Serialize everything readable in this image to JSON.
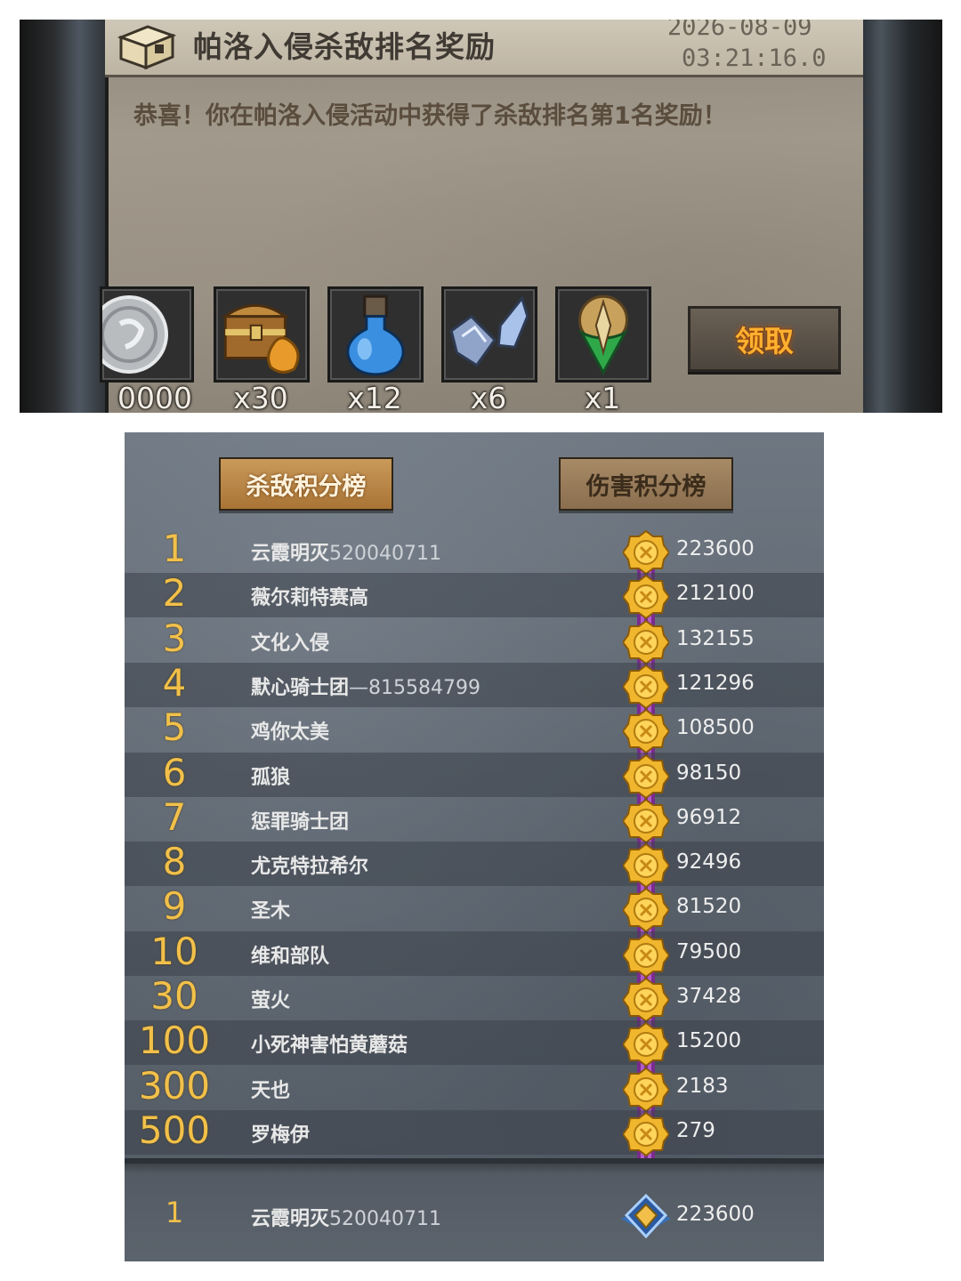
{
  "mail": {
    "title": "帕洛入侵杀敌排名奖励",
    "date": "2026-08-09",
    "time": "03:21:16.0",
    "message": "恭喜！你在帕洛入侵活动中获得了杀敌排名第1名奖励！",
    "rewards": [
      {
        "icon": "silver-coin-icon",
        "qty": "0000"
      },
      {
        "icon": "treasure-chest-icon",
        "qty": "x30"
      },
      {
        "icon": "blue-potion-icon",
        "qty": "x12"
      },
      {
        "icon": "crystal-shards-icon",
        "qty": "x6"
      },
      {
        "icon": "green-emblem-icon",
        "qty": "x1"
      }
    ],
    "claim_label": "领取"
  },
  "ranking": {
    "tabs": {
      "kill": "杀敌积分榜",
      "damage": "伤害积分榜"
    },
    "active_tab": "kill",
    "rows": [
      {
        "rank": "1",
        "name": "云霞明灭",
        "name_digits": "520040711",
        "score": "223600"
      },
      {
        "rank": "2",
        "name": "薇尔莉特赛高",
        "name_digits": "",
        "score": "212100"
      },
      {
        "rank": "3",
        "name": "文化入侵",
        "name_digits": "",
        "score": "132155"
      },
      {
        "rank": "4",
        "name": "默心骑士团",
        "name_digits": "—815584799",
        "score": "121296"
      },
      {
        "rank": "5",
        "name": "鸡你太美",
        "name_digits": "",
        "score": "108500"
      },
      {
        "rank": "6",
        "name": "孤狼",
        "name_digits": "",
        "score": "98150"
      },
      {
        "rank": "7",
        "name": "惩罪骑士团",
        "name_digits": "",
        "score": "96912"
      },
      {
        "rank": "8",
        "name": "尤克特拉希尔",
        "name_digits": "",
        "score": "92496"
      },
      {
        "rank": "9",
        "name": "圣木",
        "name_digits": "",
        "score": "81520"
      },
      {
        "rank": "10",
        "name": "维和部队",
        "name_digits": "",
        "score": "79500"
      },
      {
        "rank": "30",
        "name": "萤火",
        "name_digits": "",
        "score": "37428"
      },
      {
        "rank": "100",
        "name": "小死神害怕黄蘑菇",
        "name_digits": "",
        "score": "15200"
      },
      {
        "rank": "300",
        "name": "天也",
        "name_digits": "",
        "score": "2183"
      },
      {
        "rank": "500",
        "name": "罗梅伊",
        "name_digits": "",
        "score": "279"
      }
    ],
    "self": {
      "rank": "1",
      "name": "云霞明灭",
      "name_digits": "520040711",
      "score": "223600"
    },
    "colors": {
      "rank_gold": "#f2c04a",
      "tab_active": "#c99a5a",
      "claim_text": "#ffb030"
    }
  }
}
